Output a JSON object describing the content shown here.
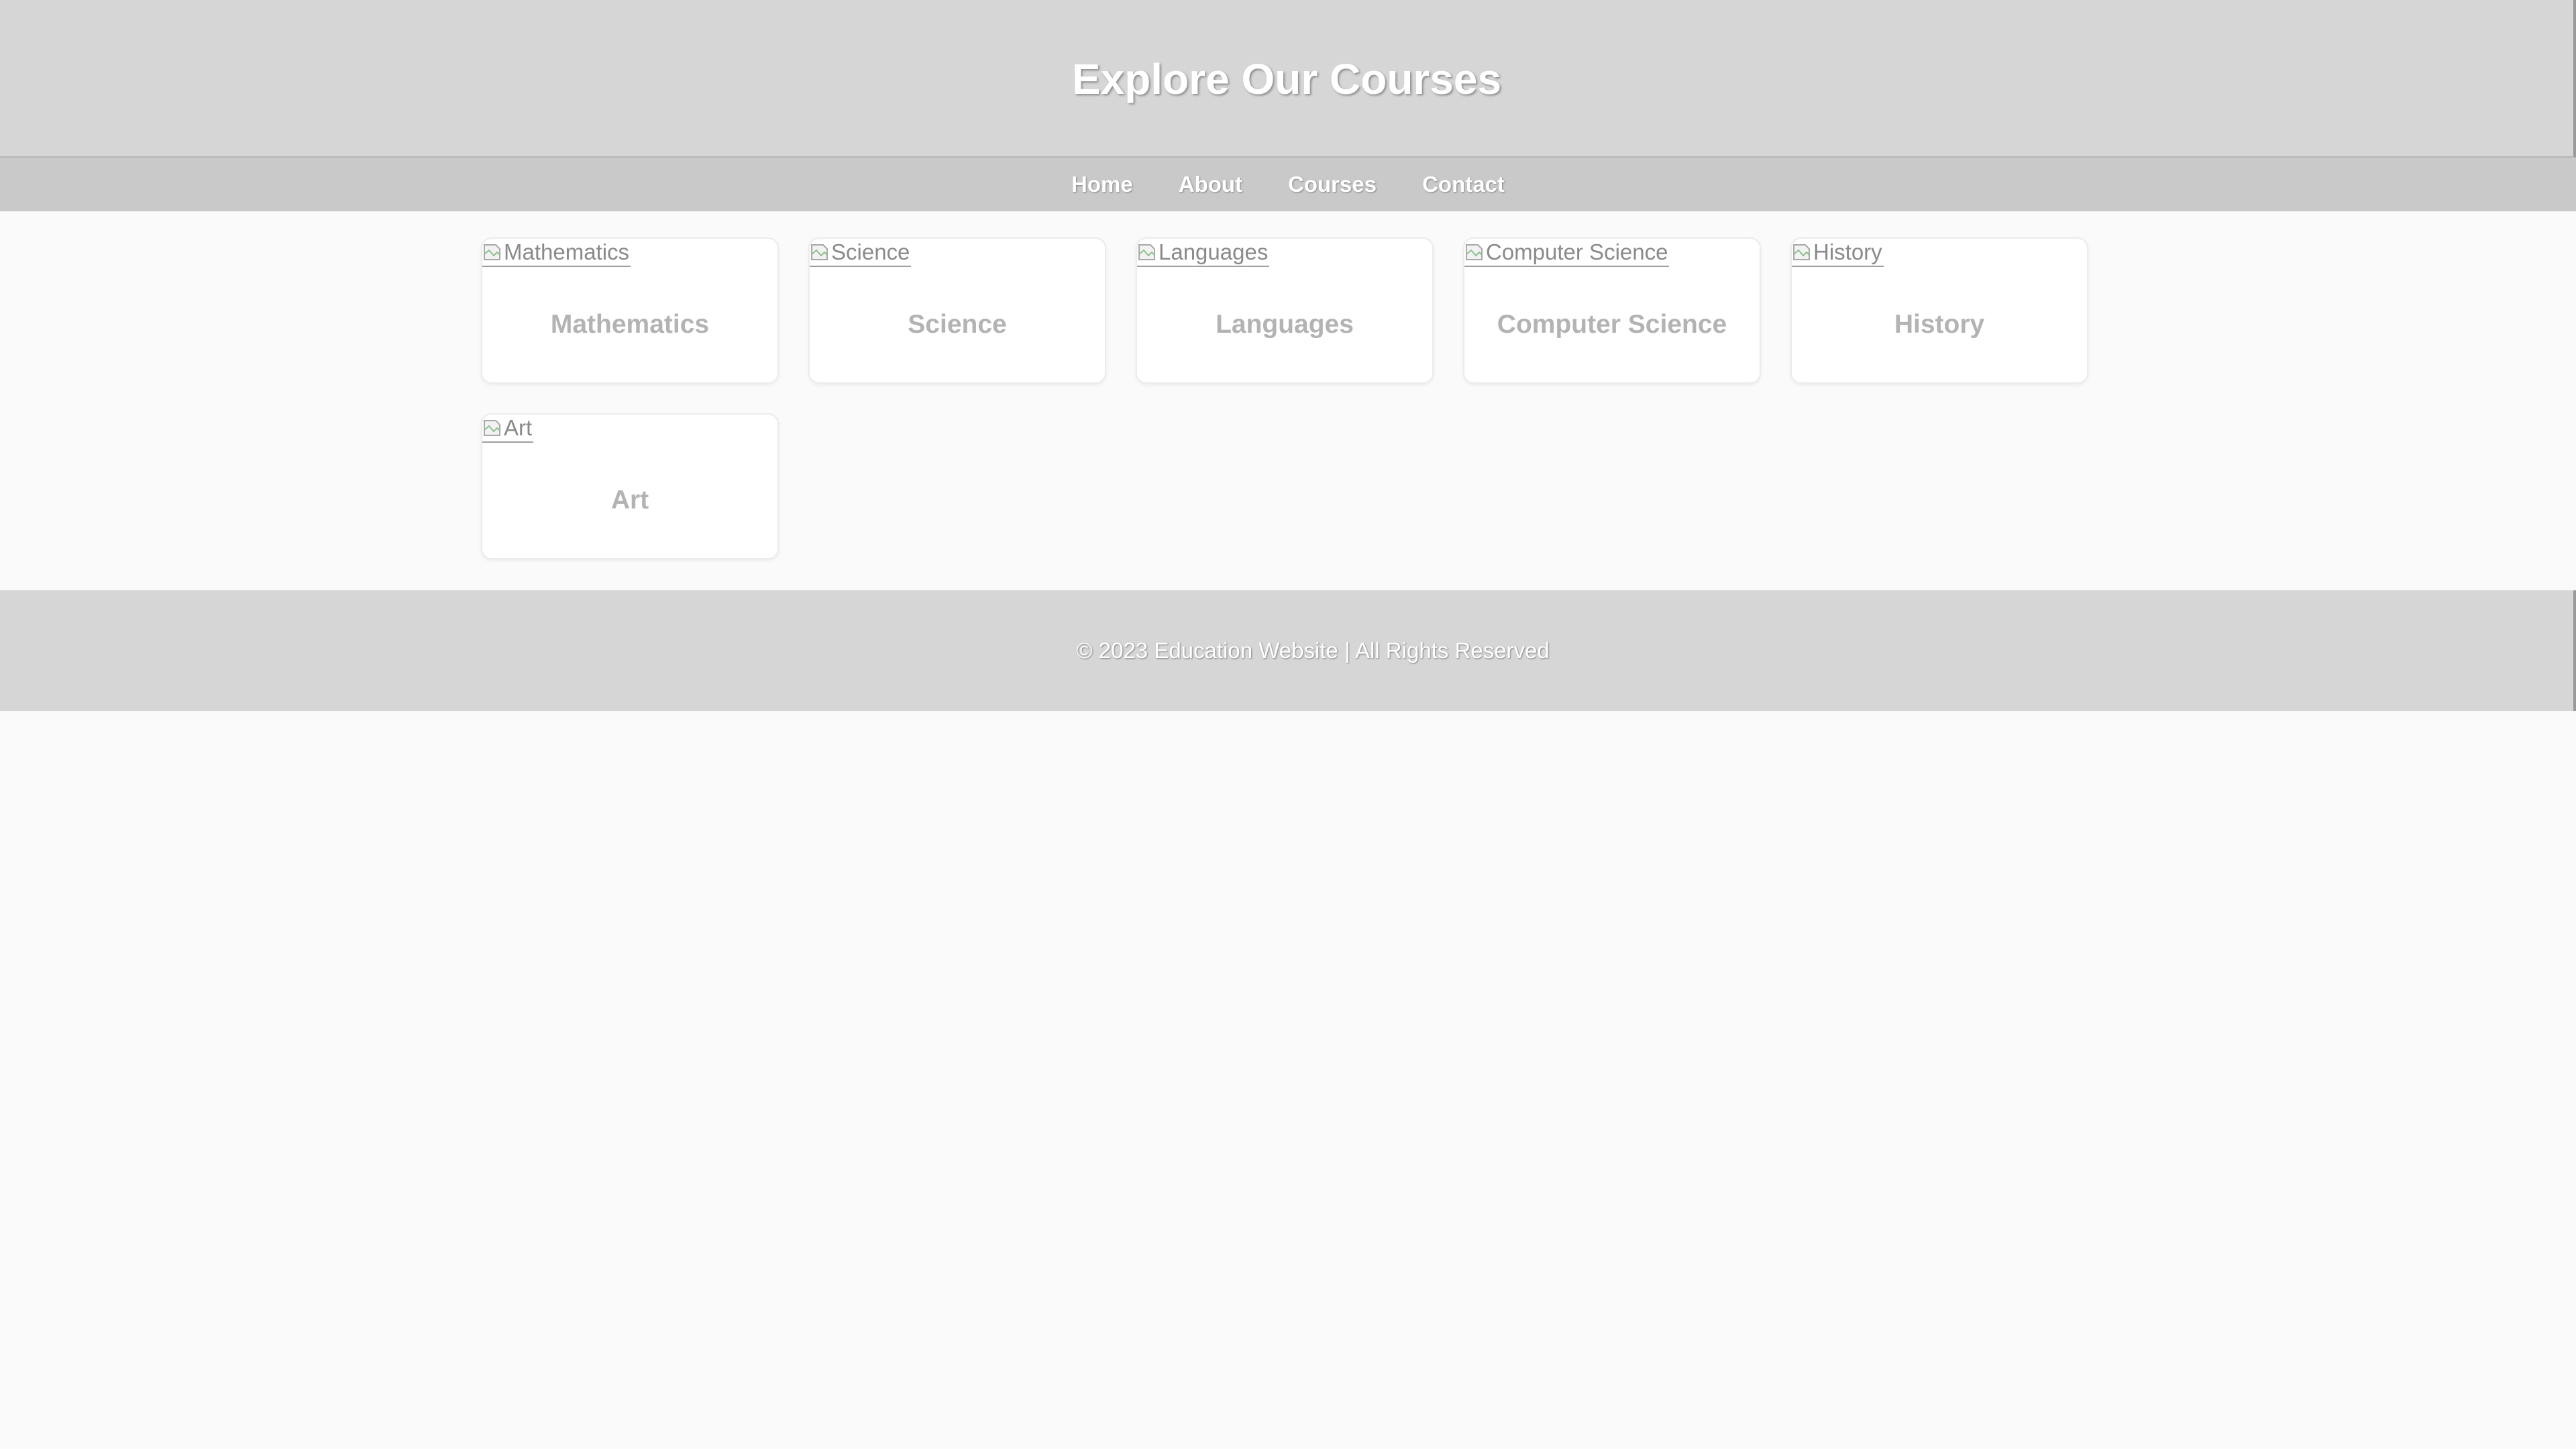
{
  "header": {
    "title": "Explore Our Courses"
  },
  "nav": {
    "items": [
      {
        "label": "Home"
      },
      {
        "label": "About"
      },
      {
        "label": "Courses"
      },
      {
        "label": "Contact"
      }
    ]
  },
  "courses": [
    {
      "alt": "Mathematics",
      "title": "Mathematics"
    },
    {
      "alt": "Science",
      "title": "Science"
    },
    {
      "alt": "Languages",
      "title": "Languages"
    },
    {
      "alt": "Computer Science",
      "title": "Computer Science"
    },
    {
      "alt": "History",
      "title": "History"
    },
    {
      "alt": "Art",
      "title": "Art"
    }
  ],
  "footer": {
    "text": "© 2023 Education Website | All Rights Reserved"
  },
  "icons": {
    "broken_image": "broken-image-icon"
  },
  "colors": {
    "header_bg": "#d6d6d6",
    "nav_bg": "#c9c9c9",
    "page_bg": "#fafafa",
    "card_title": "#b3b3b3"
  }
}
